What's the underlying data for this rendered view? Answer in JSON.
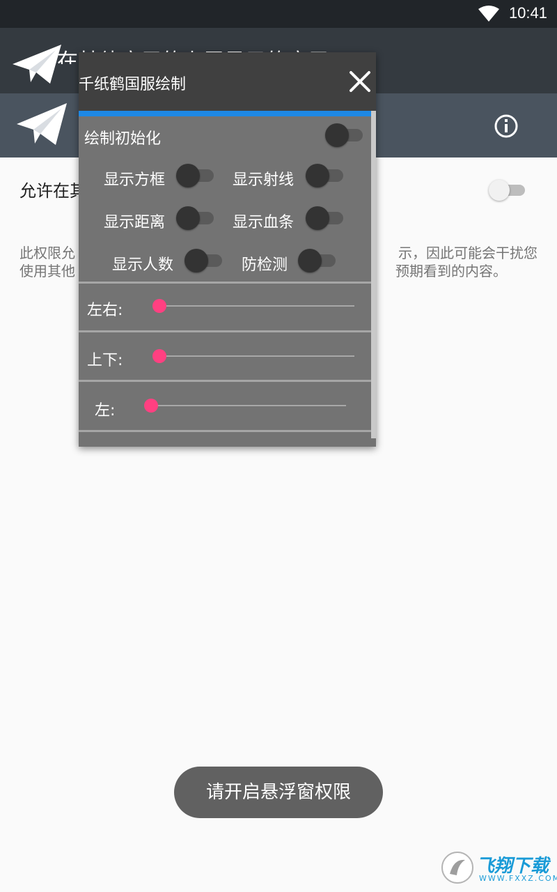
{
  "status_bar": {
    "time": "10:41",
    "icons": [
      "wifi-icon"
    ]
  },
  "toolbar": {
    "title": "在其他应用的上层显示的应用"
  },
  "app_header": {
    "logo": "telegram-plane-icon",
    "action_icon": "info-icon"
  },
  "setting": {
    "label": "允许在其",
    "enabled": false,
    "description_left_1": "此权限允",
    "description_left_2": "使用其他",
    "description_right_1": "示，因此可能会干扰您",
    "description_right_2": "预期看到的内容。"
  },
  "overlay": {
    "title": "千纸鹤国服绘制",
    "close_icon": "close-icon",
    "init": {
      "label": "绘制初始化",
      "on": false
    },
    "toggles": [
      {
        "label": "显示方框",
        "on": false
      },
      {
        "label": "显示射线",
        "on": false
      },
      {
        "label": "显示距离",
        "on": false
      },
      {
        "label": "显示血条",
        "on": false
      },
      {
        "label": "显示人数",
        "on": false
      },
      {
        "label": "防检测",
        "on": false
      }
    ],
    "sliders": [
      {
        "label": "左右:",
        "value": 0
      },
      {
        "label": "上下:",
        "value": 0
      },
      {
        "label": "左:",
        "value": 0
      }
    ]
  },
  "toast": {
    "text": "请开启悬浮窗权限"
  },
  "watermark": {
    "brand": "飞翔下载",
    "url": "WWW.FXXZ.COM"
  },
  "colors": {
    "accent_pink": "#ff4081",
    "accent_blue": "#1e88e5",
    "status_bar": "#212529",
    "header": "#4a545f"
  }
}
